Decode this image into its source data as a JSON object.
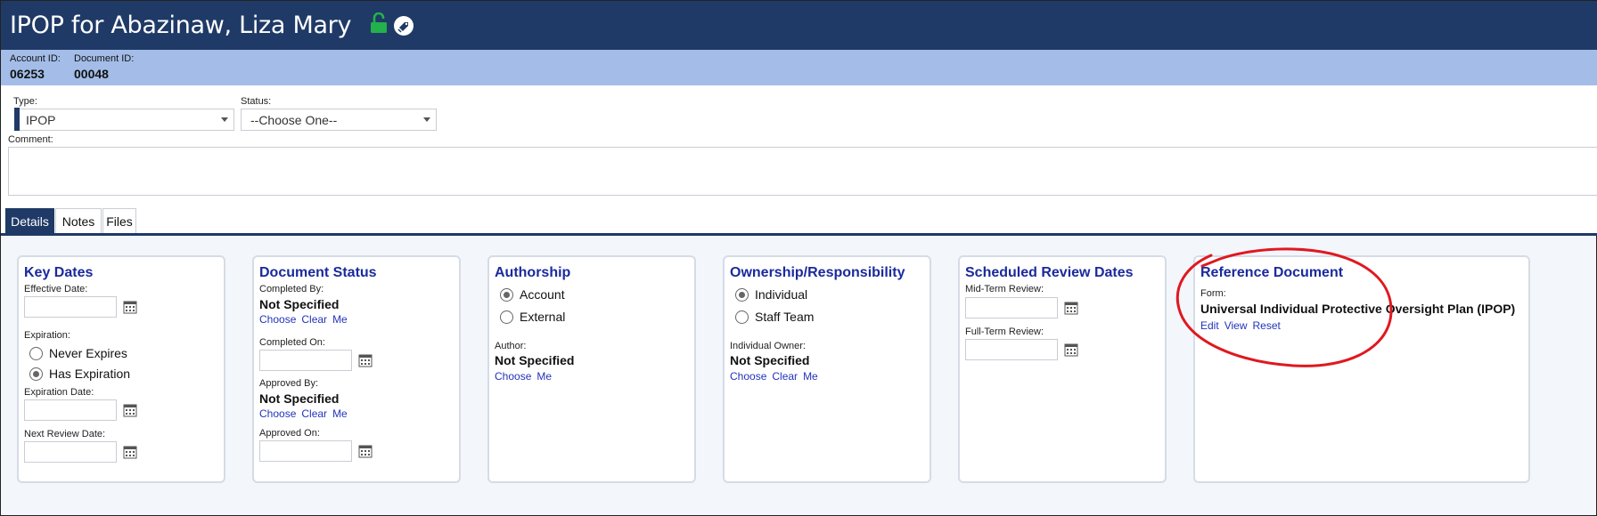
{
  "header": {
    "title": "IPOP for Abazinaw, Liza Mary",
    "lock_icon": "open-lock-icon",
    "lock_color": "#22b14c",
    "tag_icon": "tag-icon",
    "bar_color": "#1f3a66"
  },
  "ids": {
    "account_label": "Account ID:",
    "account_value": "06253",
    "document_label": "Document ID:",
    "document_value": "00048"
  },
  "form": {
    "type_label": "Type:",
    "type_value": "IPOP",
    "status_label": "Status:",
    "status_value": "--Choose One--",
    "comment_label": "Comment:"
  },
  "tabs": [
    {
      "label": "Details",
      "active": true
    },
    {
      "label": "Notes",
      "active": false
    },
    {
      "label": "Files",
      "active": false
    }
  ],
  "key_dates": {
    "title": "Key Dates",
    "effective_label": "Effective Date:",
    "expiration_label": "Expiration:",
    "never_expires": "Never Expires",
    "has_expiration": "Has Expiration",
    "selected": "Has Expiration",
    "expiration_date_label": "Expiration Date:",
    "next_review_label": "Next Review Date:"
  },
  "document_status": {
    "title": "Document Status",
    "completed_by_label": "Completed By:",
    "completed_by_value": "Not Specified",
    "completed_on_label": "Completed On:",
    "approved_by_label": "Approved By:",
    "approved_by_value": "Not Specified",
    "approved_on_label": "Approved On:",
    "link_choose": "Choose",
    "link_clear": "Clear",
    "link_me": "Me"
  },
  "authorship": {
    "title": "Authorship",
    "option_account": "Account",
    "option_external": "External",
    "selected": "Account",
    "author_label": "Author:",
    "author_value": "Not Specified",
    "link_choose": "Choose",
    "link_me": "Me"
  },
  "ownership": {
    "title": "Ownership/Responsibility",
    "option_individual": "Individual",
    "option_staff": "Staff Team",
    "selected": "Individual",
    "owner_label": "Individual Owner:",
    "owner_value": "Not Specified",
    "link_choose": "Choose",
    "link_clear": "Clear",
    "link_me": "Me"
  },
  "review_dates": {
    "title": "Scheduled Review Dates",
    "mid_label": "Mid-Term Review:",
    "full_label": "Full-Term Review:"
  },
  "reference": {
    "title": "Reference Document",
    "form_label": "Form:",
    "form_value": "Universal Individual Protective Oversight Plan (IPOP)",
    "link_edit": "Edit",
    "link_view": "View",
    "link_reset": "Reset",
    "annotation_color": "#e0181f"
  }
}
